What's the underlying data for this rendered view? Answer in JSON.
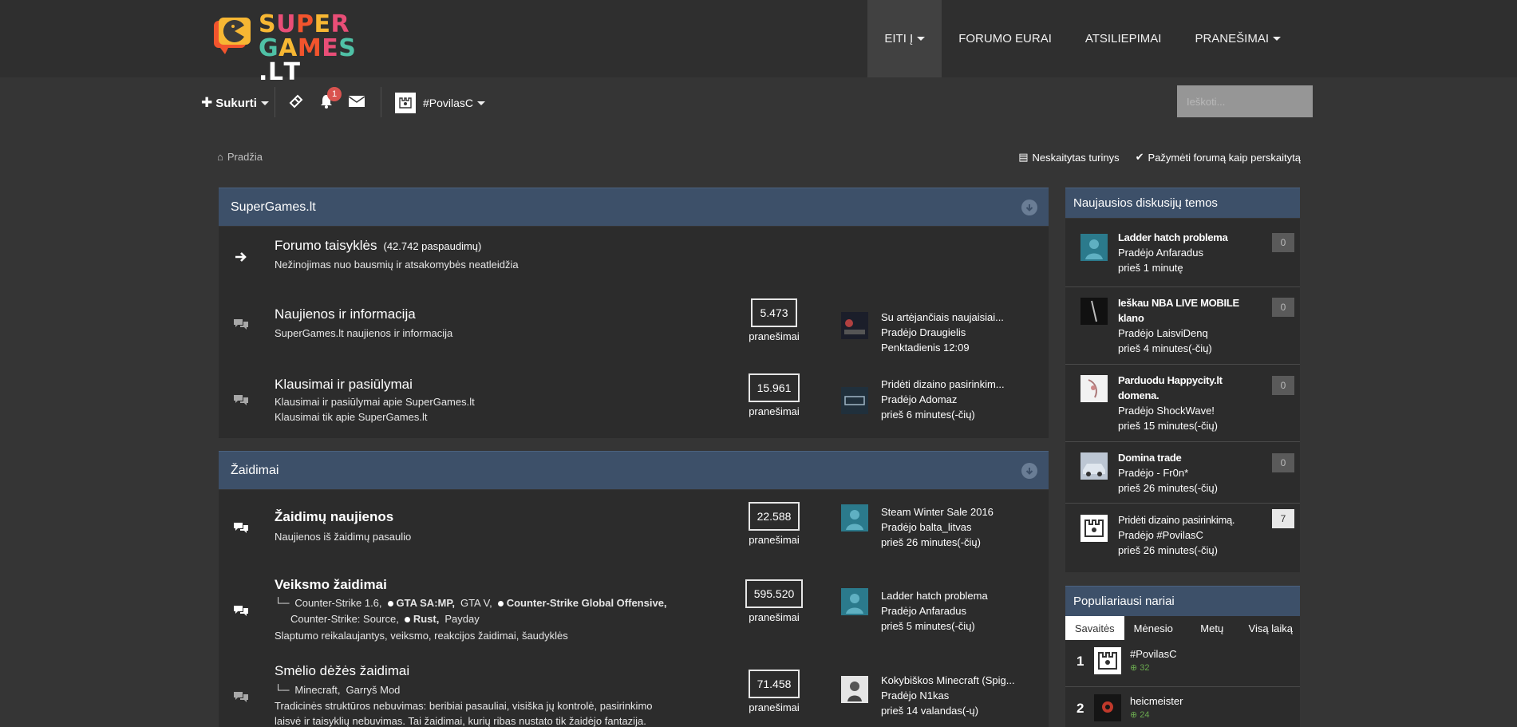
{
  "logo": {
    "line1": [
      "S",
      "U",
      "P",
      "E",
      "R"
    ],
    "line2": [
      "G",
      "A",
      "M",
      "E",
      "S",
      ".",
      "L",
      "T"
    ]
  },
  "nav": [
    {
      "label": "EITI Į",
      "caret": true,
      "active": true
    },
    {
      "label": "FORUMO EURAI",
      "caret": false,
      "active": false
    },
    {
      "label": "ATSILIEPIMAI",
      "caret": false,
      "active": false
    },
    {
      "label": "PRANEŠIMAI",
      "caret": true,
      "active": false
    }
  ],
  "userbar": {
    "create_label": "Sukurti",
    "notification_count": "1",
    "username": "#PovilasC",
    "search_placeholder": "Ieškoti..."
  },
  "breadcrumb": {
    "home": "Pradžia"
  },
  "actions": {
    "unread": "Neskaitytas turinys",
    "mark_read": "Pažymėti forumą kaip perskaitytą"
  },
  "sections": [
    {
      "title": "SuperGames.lt",
      "forums": [
        {
          "title": "Forumo taisyklės",
          "views": "(42.742 paspaudimų)",
          "desc": "Nežinojimas nuo bausmių ir atsakomybės neatleidžia"
        },
        {
          "title": "Naujienos ir informacija",
          "desc": "SuperGames.lt naujienos ir informacija",
          "posts": "5.473",
          "posts_label": "pranešimai",
          "last_title": "Su artėjančiais naujaisiai...",
          "last_by": "Pradėjo Draugielis",
          "last_time": "Penktadienis 12:09"
        },
        {
          "title": "Klausimai ir pasiūlymai",
          "desc": "Klausimai ir pasiūlymai apie SuperGames.lt",
          "desc2": "Klausimai tik apie SuperGames.lt",
          "posts": "15.961",
          "posts_label": "pranešimai",
          "last_title": "Pridėti dizaino pasirinkim...",
          "last_by": "Pradėjo Adomaz",
          "last_time": "prieš 6 minutes(-čių)"
        }
      ]
    },
    {
      "title": "Žaidimai",
      "forums": [
        {
          "title": "Žaidimų naujienos",
          "desc": "Naujienos iš žaidimų pasaulio",
          "posts": "22.588",
          "posts_label": "pranešimai",
          "last_title": "Steam Winter Sale 2016",
          "last_by": "Pradėjo balta_litvas",
          "last_time": "prieš 26 minutes(-čių)"
        },
        {
          "title": "Veiksmo žaidimai",
          "subforums": [
            "Counter-Strike 1.6,",
            "GTA SA:MP,",
            "GTA V,",
            "Counter-Strike Global Offensive,",
            "Counter-Strike: Source,",
            "Rust,",
            "Payday"
          ],
          "desc": "Slaptumo reikalaujantys, veiksmo, reakcijos žaidimai, šaudyklės",
          "posts": "595.520",
          "posts_label": "pranešimai",
          "last_title": "Ladder hatch problema",
          "last_by": "Pradėjo Anfaradus",
          "last_time": "prieš 5 minutes(-čių)"
        },
        {
          "title": "Smėlio dėžės žaidimai",
          "subforums": [
            "Minecraft,",
            "Garryš Mod"
          ],
          "desc": "Tradicinės struktūros nebuvimas: beribiai pasauliai, visiška jų kontrolė, pasirinkimo",
          "desc2": "laisvė ir taisyklių nebuvimas. Tai žaidimai, kurių ribas nustato tik žaidėjo fantazija.",
          "posts": "71.458",
          "posts_label": "pranešimai",
          "last_title": "Kokybiškos Minecraft (Spig...",
          "last_by": "Pradėjo N1kas",
          "last_time": "prieš 14 valandas(-ų)"
        }
      ]
    }
  ],
  "sidebar": {
    "discussions_title": "Naujausios diskusijų temos",
    "discussions": [
      {
        "title": "Ladder hatch problema",
        "by": "Pradėjo Anfaradus",
        "time": "prieš 1 minutę",
        "count": "0"
      },
      {
        "title": "Ieškau NBA LIVE MOBILE",
        "title2": "klano",
        "by": "Pradėjo LaisviDenq",
        "time": "prieš 4 minutes(-čių)",
        "count": "0"
      },
      {
        "title": "Parduodu Happycity.lt",
        "title2": "domena.",
        "by": "Pradėjo ShockWave!",
        "time": "prieš 15 minutes(-čių)",
        "count": "0"
      },
      {
        "title": "Domina trade",
        "by": "Pradėjo - Fr0n*",
        "time": "prieš 26 minutes(-čių)",
        "count": "0"
      },
      {
        "title": "Pridėti dizaino pasirinkimą.",
        "by": "Pradėjo #PovilasC",
        "time": "prieš 26 minutes(-čių)",
        "count": "7"
      }
    ],
    "members_title": "Populiariausi nariai",
    "tabs": [
      "Savaitės",
      "Mėnesio",
      "Metų",
      "Visą laiką"
    ],
    "members": [
      {
        "rank": "1",
        "name": "#PovilasC",
        "points": "32"
      },
      {
        "rank": "2",
        "name": "heicmeister",
        "points": "24"
      }
    ]
  },
  "colors": {
    "accent": "#3d5069",
    "background": "#353535",
    "panel": "#2c2c2c",
    "header": "#2f2f2f"
  }
}
